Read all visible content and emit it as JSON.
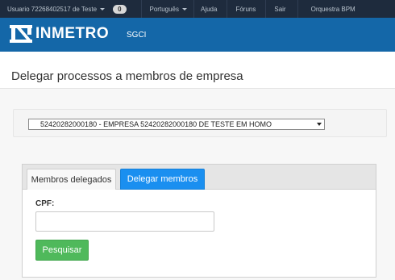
{
  "topbar": {
    "user_label": "Usuario 72268402517 de Teste",
    "badge_count": "0",
    "language_label": "Português",
    "help_label": "Ajuda",
    "forums_label": "Fóruns",
    "exit_label": "Sair",
    "bpm_label": "Orquestra BPM"
  },
  "brand": {
    "logo_text": "INMETRO",
    "system_name": "SGCI"
  },
  "page": {
    "title": "Delegar processos a membros de empresa"
  },
  "company_select": {
    "selected_value": "52420282000180 - EMPRESA 52420282000180 DE TESTE EM HOMO"
  },
  "tabs": [
    {
      "label": "Membros delegados",
      "active": false
    },
    {
      "label": "Delegar membros",
      "active": true
    }
  ],
  "form": {
    "cpf_label": "CPF:",
    "cpf_value": "",
    "search_button_label": "Pesquisar"
  },
  "colors": {
    "topbar_bg": "#1e2b3d",
    "brand_bg": "#1467a8",
    "active_tab": "#1a8ff0",
    "search_button": "#4fb95b"
  }
}
